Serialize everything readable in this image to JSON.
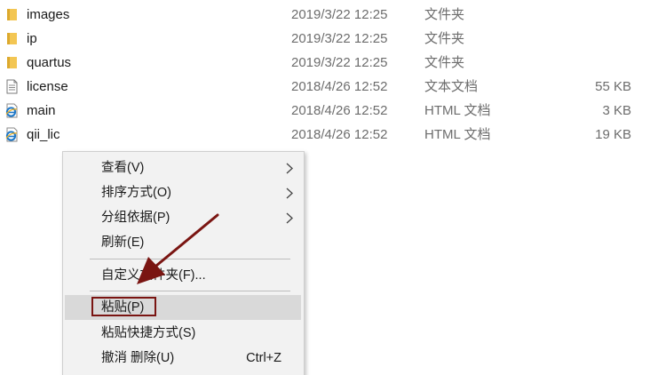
{
  "files": [
    {
      "name": "images",
      "date": "2019/3/22 12:25",
      "type": "文件夹",
      "size": "",
      "icon": "folder-icon"
    },
    {
      "name": "ip",
      "date": "2019/3/22 12:25",
      "type": "文件夹",
      "size": "",
      "icon": "folder-icon"
    },
    {
      "name": "quartus",
      "date": "2019/3/22 12:25",
      "type": "文件夹",
      "size": "",
      "icon": "folder-icon"
    },
    {
      "name": "license",
      "date": "2018/4/26 12:52",
      "type": "文本文档",
      "size": "55 KB",
      "icon": "text-document-icon"
    },
    {
      "name": "main",
      "date": "2018/4/26 12:52",
      "type": "HTML 文档",
      "size": "3 KB",
      "icon": "html-document-icon"
    },
    {
      "name": "qii_lic",
      "date": "2018/4/26 12:52",
      "type": "HTML 文档",
      "size": "19 KB",
      "icon": "html-document-icon"
    }
  ],
  "context_menu": {
    "view": "查看(V)",
    "sort": "排序方式(O)",
    "group": "分组依据(P)",
    "refresh": "刷新(E)",
    "customize": "自定义文件夹(F)...",
    "paste": "粘贴(P)",
    "paste_shortcut": "粘贴快捷方式(S)",
    "undo_delete": "撤消 删除(U)",
    "undo_shortcut": "Ctrl+Z"
  },
  "colors": {
    "folder": "#f3c653",
    "annotation": "#7a1512",
    "highlight": "#d9d9d9",
    "menu_bg": "#f2f2f2"
  }
}
